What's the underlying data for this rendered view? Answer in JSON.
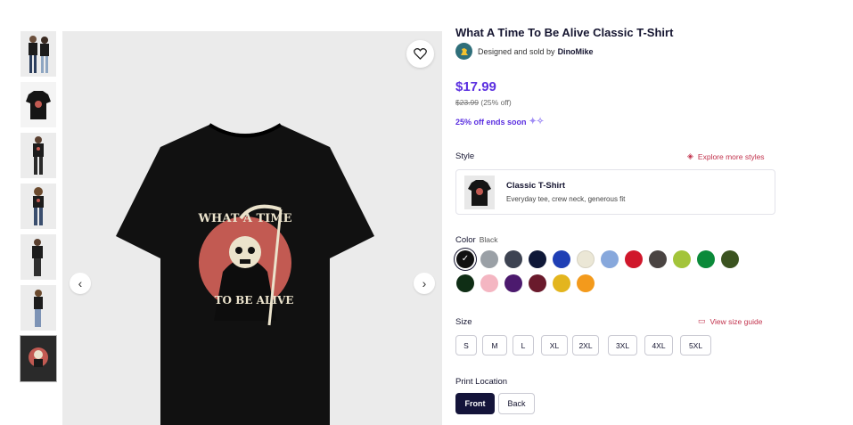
{
  "product": {
    "title": "What A Time To Be Alive Classic T-Shirt",
    "designed_by_label": "Designed and sold by",
    "designer": "DinoMike",
    "price": "$17.99",
    "original_price": "$23.99",
    "discount": "(25% off)",
    "promo": "25% off ends soon"
  },
  "gallery": {
    "thumbnail_count": 7,
    "selected_index": 6,
    "shirt_print_top": "WHAT A TIME",
    "shirt_print_bottom": "TO BE ALIVE"
  },
  "style": {
    "label": "Style",
    "explore_link": "Explore more styles",
    "selected_name": "Classic T-Shirt",
    "selected_desc": "Everyday tee, crew neck, generous fit"
  },
  "color": {
    "label": "Color",
    "selected": "Black",
    "swatches": [
      "#111111",
      "#9aa0a6",
      "#3d4352",
      "#0f1838",
      "#1f3fb5",
      "#ebe7d6",
      "#87a8dc",
      "#d0172b",
      "#4a4442",
      "#a3c43a",
      "#0b8a3a",
      "#3b5320",
      "#0f2e15",
      "#f4b6c2",
      "#4c1a6e",
      "#6a1a2c",
      "#e3b51e",
      "#f39a1c"
    ]
  },
  "size": {
    "label": "Size",
    "guide_link": "View size guide",
    "options": [
      "S",
      "M",
      "L",
      "XL",
      "2XL",
      "3XL",
      "4XL",
      "5XL"
    ]
  },
  "print_location": {
    "label": "Print Location",
    "options": [
      "Front",
      "Back"
    ],
    "selected": "Front"
  },
  "colors": {
    "accent": "#5b2fe0",
    "link_red": "#c2334d",
    "dark_button": "#14143a"
  }
}
